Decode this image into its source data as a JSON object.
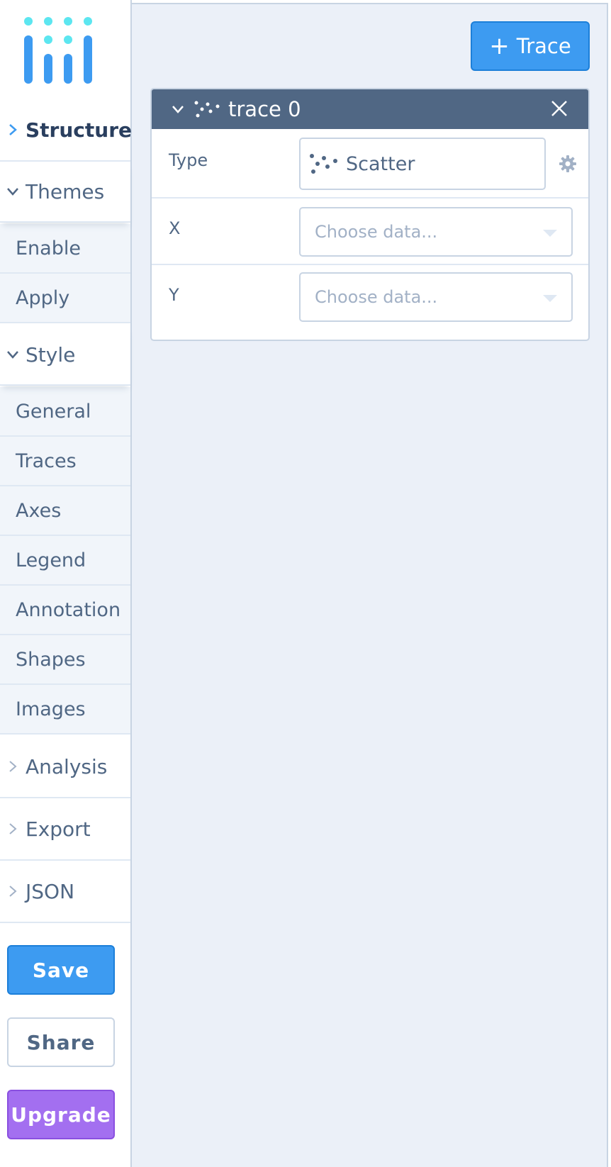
{
  "sidebar": {
    "groups": {
      "structure": "Structure",
      "themes": "Themes",
      "style": "Style",
      "analysis": "Analysis",
      "export": "Export",
      "json": "JSON"
    },
    "themes_items": [
      "Enable",
      "Apply"
    ],
    "style_items": [
      "General",
      "Traces",
      "Axes",
      "Legend",
      "Annotation",
      "Shapes",
      "Images"
    ],
    "buttons": {
      "save": "Save",
      "share": "Share",
      "upgrade": "Upgrade"
    }
  },
  "main": {
    "add_trace_label": "Trace",
    "trace_panel": {
      "title": "trace 0",
      "rows": {
        "type_label": "Type",
        "type_value": "Scatter",
        "x_label": "X",
        "x_placeholder": "Choose data...",
        "y_label": "Y",
        "y_placeholder": "Choose data..."
      }
    }
  },
  "icons": {
    "logo": "plotly-logo",
    "trace_type": "scatter-icon",
    "settings": "gear-icon",
    "close": "close-icon",
    "expand": "chevron-icon"
  },
  "colors": {
    "accent": "#3d9bf1",
    "upgrade": "#a36ff0",
    "panel_header": "#506784",
    "logo": "#3d9bf1",
    "logo_dots": "#5ce6f0"
  }
}
